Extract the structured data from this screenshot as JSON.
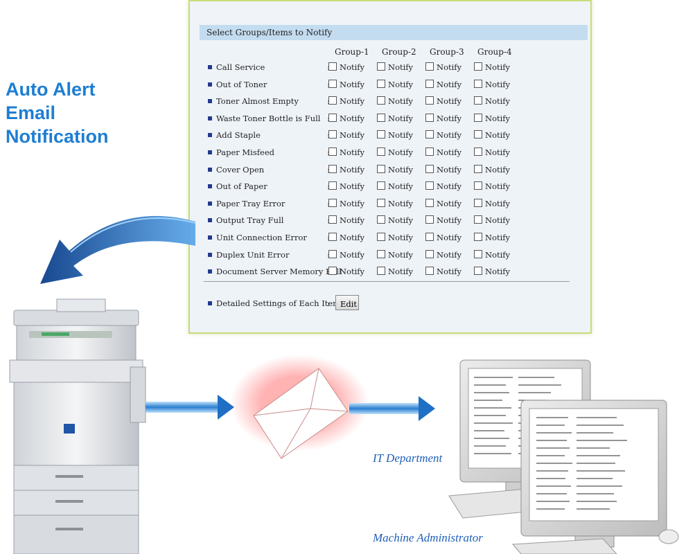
{
  "headline": {
    "lines": [
      "Auto Alert",
      "Email",
      "Notification"
    ]
  },
  "panel": {
    "title": "Select Groups/Items to Notify",
    "groups": [
      "Group-1",
      "Group-2",
      "Group-3",
      "Group-4"
    ],
    "checkbox_label": "Notify",
    "items": [
      "Call Service",
      "Out of Toner",
      "Toner Almost Empty",
      "Waste Toner Bottle is Full",
      "Add Staple",
      "Paper Misfeed",
      "Cover Open",
      "Out of Paper",
      "Paper Tray Error",
      "Output Tray Full",
      "Unit Connection Error",
      "Duplex Unit Error",
      "Document Server Memory Full"
    ],
    "detail_label": "Detailed Settings of Each Item",
    "edit_label": "Edit",
    "colon": ":"
  },
  "captions": {
    "it_department": "IT Department",
    "machine_administrator": "Machine Administrator"
  },
  "colors": {
    "headline": "#1e7ed2",
    "caption": "#1e5fb8",
    "arrow": "#1f6fc4",
    "panel_border": "#c8dc7a"
  },
  "icons": [
    "curved-arrow-icon",
    "copier-icon",
    "right-arrow-icon",
    "envelope-icon",
    "monitor-icon",
    "keyboard-icon",
    "mouse-icon"
  ]
}
